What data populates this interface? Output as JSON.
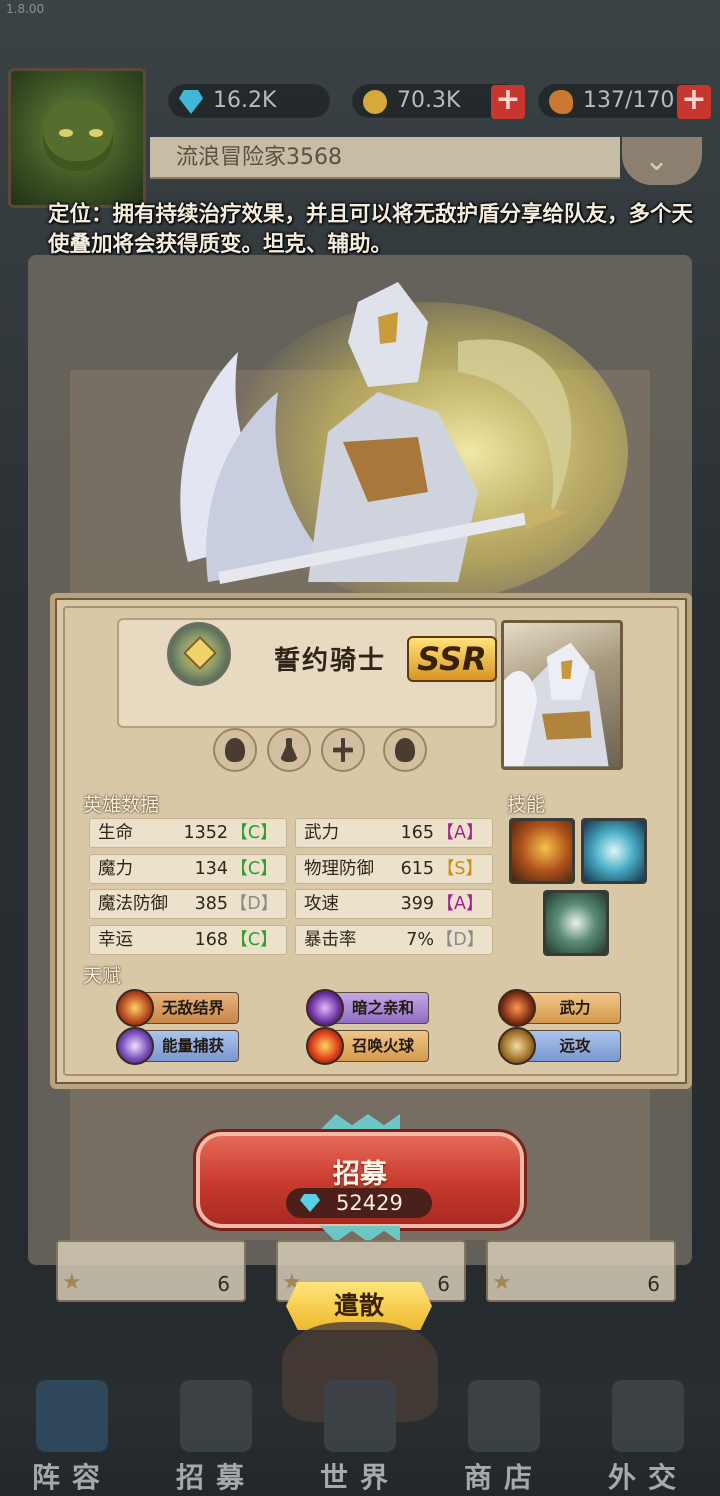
{
  "version": "1.8.00",
  "resources": {
    "gems": "16.2K",
    "gold": "70.3K",
    "food": "137/170",
    "plus": "+"
  },
  "player": {
    "name": "流浪冒险家3568"
  },
  "description": "定位：拥有持续治疗效果，并且可以将无敌护盾分享给队友，多个天使叠加将会获得质变。坦克、辅助。",
  "hero": {
    "name": "誓约骑士",
    "rarity": "SSR",
    "tags": [
      "female-icon",
      "flask-icon",
      "cross-icon",
      "body-icon"
    ]
  },
  "sections": {
    "stats": "英雄数据",
    "skills": "技能",
    "talents": "天赋"
  },
  "stats": [
    {
      "label": "生命",
      "value": "1352",
      "grade": "【C】"
    },
    {
      "label": "武力",
      "value": "165",
      "grade": "【A】"
    },
    {
      "label": "魔力",
      "value": "134",
      "grade": "【C】"
    },
    {
      "label": "物理防御",
      "value": "615",
      "grade": "【S】"
    },
    {
      "label": "魔法防御",
      "value": "385",
      "grade": "【D】"
    },
    {
      "label": "攻速",
      "value": "399",
      "grade": "【A】"
    },
    {
      "label": "幸运",
      "value": "168",
      "grade": "【C】"
    },
    {
      "label": "暴击率",
      "value": "7%",
      "grade": "【D】"
    }
  ],
  "grade_colors": {
    "C": "#2f9d2e",
    "A": "#a31f8f",
    "S": "#c88d12",
    "D": "#8a8a8a"
  },
  "skills": [
    "hammer-skill-icon",
    "winged-shield-skill-icon",
    "holy-cross-skill-icon"
  ],
  "talents": [
    "无敌结界",
    "暗之亲和",
    "武力",
    "能量捕获",
    "召唤火球",
    "远攻"
  ],
  "recruit": {
    "label": "招募",
    "cost": "52429"
  },
  "cards": [
    {
      "count": "6"
    },
    {
      "count": "6"
    },
    {
      "count": "6"
    }
  ],
  "dismiss": "遣散",
  "nav": [
    "阵容",
    "招募",
    "世界",
    "商店",
    "外交"
  ]
}
